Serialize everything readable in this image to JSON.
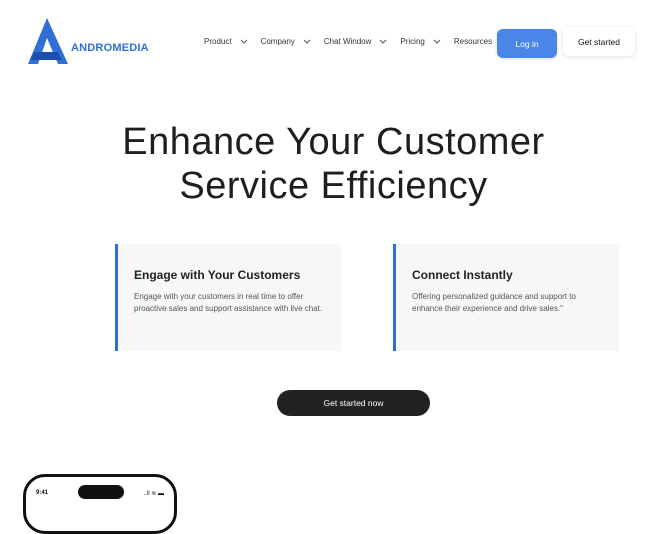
{
  "brand": {
    "name": "ANDROMEDIA",
    "color": "#2f6fd6"
  },
  "nav": {
    "items": [
      {
        "label": "Product",
        "has_dropdown": true
      },
      {
        "label": "Company",
        "has_dropdown": true
      },
      {
        "label": "Chat Window",
        "has_dropdown": true
      },
      {
        "label": "Pricing",
        "has_dropdown": true
      },
      {
        "label": "Resources",
        "has_dropdown": false
      }
    ],
    "login_label": "Log in",
    "get_started_label": "Get started"
  },
  "hero": {
    "title_line1": "Enhance Your Customer",
    "title_line2": "Service Efficiency"
  },
  "cards": [
    {
      "title": "Engage with Your Customers",
      "text": "Engage with your customers in real time to offer proactive sales and support assistance with live chat."
    },
    {
      "title": "Connect Instantly",
      "text": "Offering personalized guidance and support to enhance their experience and drive sales.\""
    }
  ],
  "cta": {
    "label": "Get started now"
  },
  "phone": {
    "time": "9:41",
    "status": "..ll ≋ ▬"
  },
  "colors": {
    "accent": "#4a86e8",
    "card_border": "#2f6fd6",
    "cta_bg": "#222222"
  }
}
